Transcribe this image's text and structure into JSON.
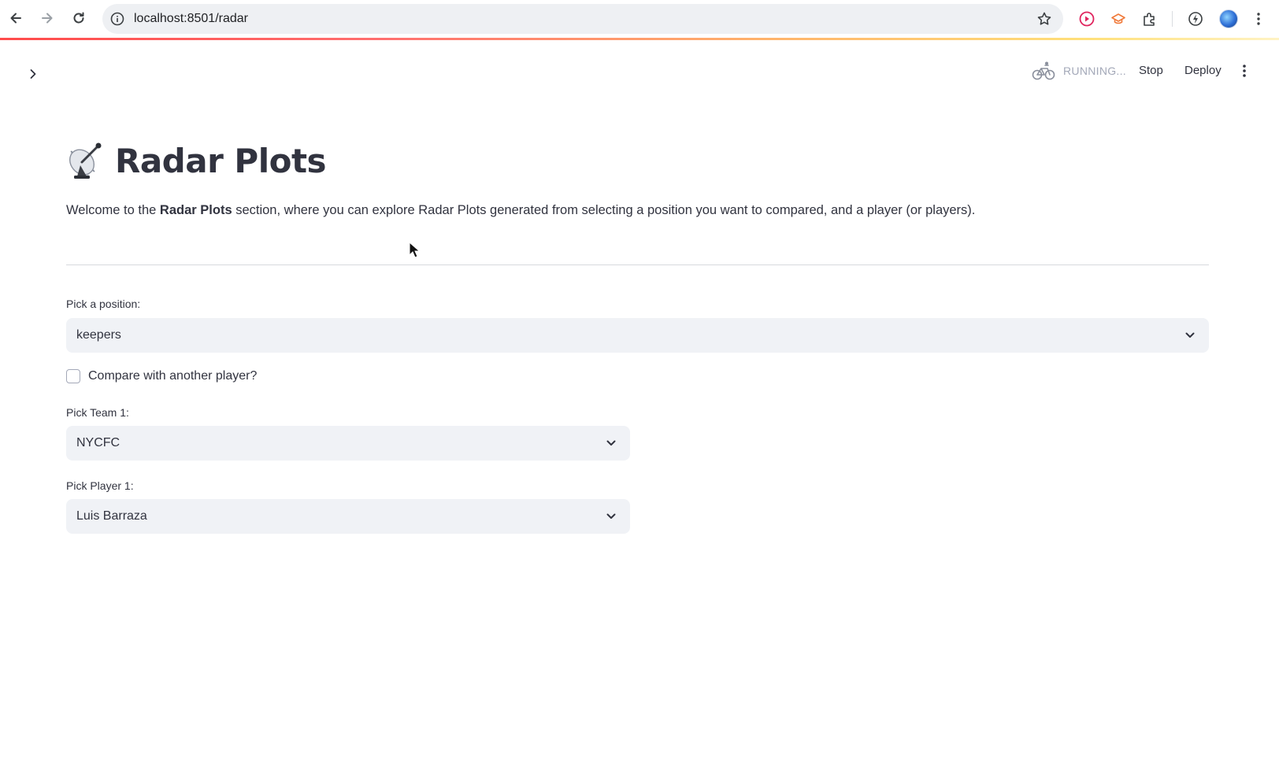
{
  "browser": {
    "url": "localhost:8501/radar"
  },
  "header": {
    "status_text": "RUNNING...",
    "stop_label": "Stop",
    "deploy_label": "Deploy"
  },
  "main": {
    "title": "Radar Plots",
    "title_emoji": "satellite-antenna",
    "intro_prefix": "Welcome to the ",
    "intro_bold": "Radar Plots",
    "intro_suffix": " section, where you can explore Radar Plots generated from selecting a position you want to compared, and a player (or players)."
  },
  "form": {
    "position": {
      "label": "Pick a position:",
      "value": "keepers"
    },
    "compare": {
      "label": "Compare with another player?",
      "checked": false
    },
    "team1": {
      "label": "Pick Team 1:",
      "value": "NYCFC"
    },
    "player1": {
      "label": "Pick Player 1:",
      "value": "Luis Barraza"
    }
  },
  "colors": {
    "accent": "#ff4b4b",
    "text": "#31333f",
    "select_bg": "#f0f2f6",
    "muted": "#a3a8b8"
  }
}
